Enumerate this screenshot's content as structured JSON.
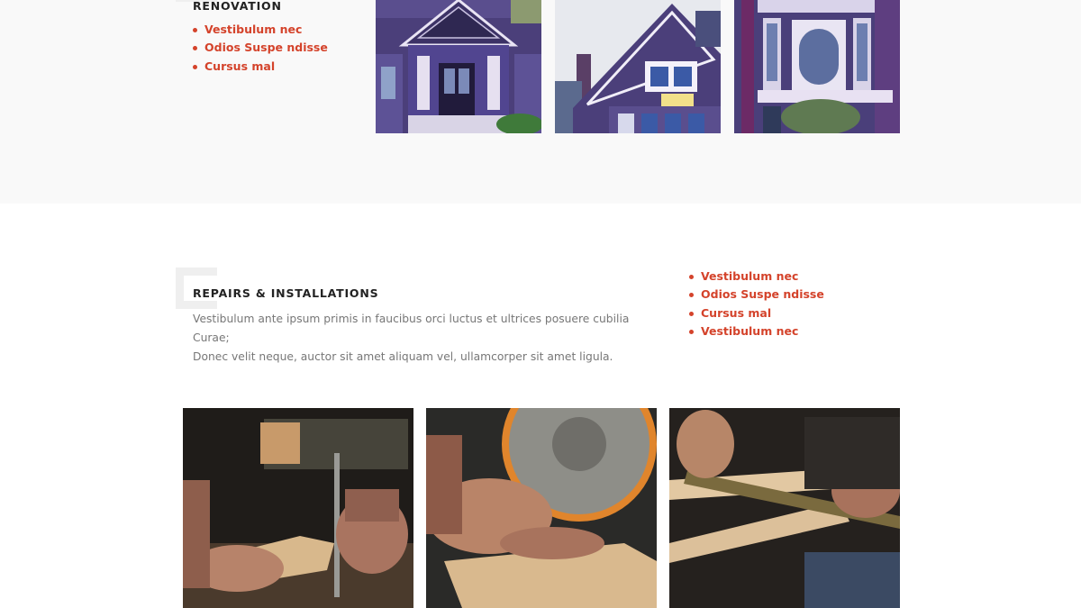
{
  "renovation": {
    "heading": "RENOVATION",
    "items": [
      "Vestibulum nec",
      "Odios Suspe ndisse",
      "Cursus mal"
    ]
  },
  "repairs": {
    "heading": "REPAIRS & INSTALLATIONS",
    "description_line1": "Vestibulum ante ipsum primis in faucibus orci luctus et ultrices posuere cubilia Curae;",
    "description_line2": "Donec velit neque, auctor sit amet aliquam vel, ullamcorper sit amet ligula.",
    "items": [
      "Vestibulum nec",
      "Odios Suspe ndisse",
      "Cursus mal",
      "Vestibulum nec"
    ]
  },
  "photos": {
    "houses": [
      "victorian-house-porch-photo",
      "victorian-house-gable-photo",
      "victorian-house-bay-window-photo"
    ],
    "woodwork": [
      "hand-saw-cutting-wood-photo",
      "circular-saw-wood-photo",
      "measuring-wood-frame-photo"
    ]
  },
  "colors": {
    "accent": "#d4432b",
    "heading": "#222222",
    "body_text": "#777777",
    "band_background": "#f9f9f9"
  }
}
